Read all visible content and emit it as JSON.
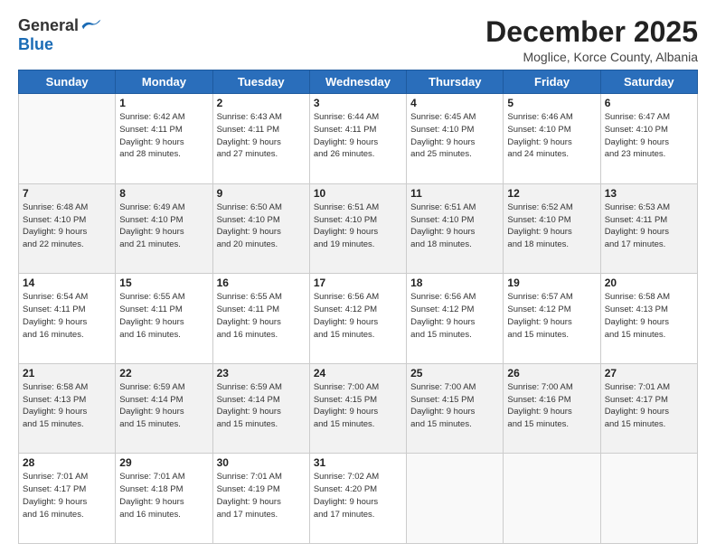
{
  "logo": {
    "general": "General",
    "blue": "Blue"
  },
  "title": "December 2025",
  "subtitle": "Moglice, Korce County, Albania",
  "days": [
    "Sunday",
    "Monday",
    "Tuesday",
    "Wednesday",
    "Thursday",
    "Friday",
    "Saturday"
  ],
  "weeks": [
    [
      {
        "day": "",
        "info": ""
      },
      {
        "day": "1",
        "info": "Sunrise: 6:42 AM\nSunset: 4:11 PM\nDaylight: 9 hours\nand 28 minutes."
      },
      {
        "day": "2",
        "info": "Sunrise: 6:43 AM\nSunset: 4:11 PM\nDaylight: 9 hours\nand 27 minutes."
      },
      {
        "day": "3",
        "info": "Sunrise: 6:44 AM\nSunset: 4:11 PM\nDaylight: 9 hours\nand 26 minutes."
      },
      {
        "day": "4",
        "info": "Sunrise: 6:45 AM\nSunset: 4:10 PM\nDaylight: 9 hours\nand 25 minutes."
      },
      {
        "day": "5",
        "info": "Sunrise: 6:46 AM\nSunset: 4:10 PM\nDaylight: 9 hours\nand 24 minutes."
      },
      {
        "day": "6",
        "info": "Sunrise: 6:47 AM\nSunset: 4:10 PM\nDaylight: 9 hours\nand 23 minutes."
      }
    ],
    [
      {
        "day": "7",
        "info": "Sunrise: 6:48 AM\nSunset: 4:10 PM\nDaylight: 9 hours\nand 22 minutes."
      },
      {
        "day": "8",
        "info": "Sunrise: 6:49 AM\nSunset: 4:10 PM\nDaylight: 9 hours\nand 21 minutes."
      },
      {
        "day": "9",
        "info": "Sunrise: 6:50 AM\nSunset: 4:10 PM\nDaylight: 9 hours\nand 20 minutes."
      },
      {
        "day": "10",
        "info": "Sunrise: 6:51 AM\nSunset: 4:10 PM\nDaylight: 9 hours\nand 19 minutes."
      },
      {
        "day": "11",
        "info": "Sunrise: 6:51 AM\nSunset: 4:10 PM\nDaylight: 9 hours\nand 18 minutes."
      },
      {
        "day": "12",
        "info": "Sunrise: 6:52 AM\nSunset: 4:10 PM\nDaylight: 9 hours\nand 18 minutes."
      },
      {
        "day": "13",
        "info": "Sunrise: 6:53 AM\nSunset: 4:11 PM\nDaylight: 9 hours\nand 17 minutes."
      }
    ],
    [
      {
        "day": "14",
        "info": "Sunrise: 6:54 AM\nSunset: 4:11 PM\nDaylight: 9 hours\nand 16 minutes."
      },
      {
        "day": "15",
        "info": "Sunrise: 6:55 AM\nSunset: 4:11 PM\nDaylight: 9 hours\nand 16 minutes."
      },
      {
        "day": "16",
        "info": "Sunrise: 6:55 AM\nSunset: 4:11 PM\nDaylight: 9 hours\nand 16 minutes."
      },
      {
        "day": "17",
        "info": "Sunrise: 6:56 AM\nSunset: 4:12 PM\nDaylight: 9 hours\nand 15 minutes."
      },
      {
        "day": "18",
        "info": "Sunrise: 6:56 AM\nSunset: 4:12 PM\nDaylight: 9 hours\nand 15 minutes."
      },
      {
        "day": "19",
        "info": "Sunrise: 6:57 AM\nSunset: 4:12 PM\nDaylight: 9 hours\nand 15 minutes."
      },
      {
        "day": "20",
        "info": "Sunrise: 6:58 AM\nSunset: 4:13 PM\nDaylight: 9 hours\nand 15 minutes."
      }
    ],
    [
      {
        "day": "21",
        "info": "Sunrise: 6:58 AM\nSunset: 4:13 PM\nDaylight: 9 hours\nand 15 minutes."
      },
      {
        "day": "22",
        "info": "Sunrise: 6:59 AM\nSunset: 4:14 PM\nDaylight: 9 hours\nand 15 minutes."
      },
      {
        "day": "23",
        "info": "Sunrise: 6:59 AM\nSunset: 4:14 PM\nDaylight: 9 hours\nand 15 minutes."
      },
      {
        "day": "24",
        "info": "Sunrise: 7:00 AM\nSunset: 4:15 PM\nDaylight: 9 hours\nand 15 minutes."
      },
      {
        "day": "25",
        "info": "Sunrise: 7:00 AM\nSunset: 4:15 PM\nDaylight: 9 hours\nand 15 minutes."
      },
      {
        "day": "26",
        "info": "Sunrise: 7:00 AM\nSunset: 4:16 PM\nDaylight: 9 hours\nand 15 minutes."
      },
      {
        "day": "27",
        "info": "Sunrise: 7:01 AM\nSunset: 4:17 PM\nDaylight: 9 hours\nand 15 minutes."
      }
    ],
    [
      {
        "day": "28",
        "info": "Sunrise: 7:01 AM\nSunset: 4:17 PM\nDaylight: 9 hours\nand 16 minutes."
      },
      {
        "day": "29",
        "info": "Sunrise: 7:01 AM\nSunset: 4:18 PM\nDaylight: 9 hours\nand 16 minutes."
      },
      {
        "day": "30",
        "info": "Sunrise: 7:01 AM\nSunset: 4:19 PM\nDaylight: 9 hours\nand 17 minutes."
      },
      {
        "day": "31",
        "info": "Sunrise: 7:02 AM\nSunset: 4:20 PM\nDaylight: 9 hours\nand 17 minutes."
      },
      {
        "day": "",
        "info": ""
      },
      {
        "day": "",
        "info": ""
      },
      {
        "day": "",
        "info": ""
      }
    ]
  ]
}
